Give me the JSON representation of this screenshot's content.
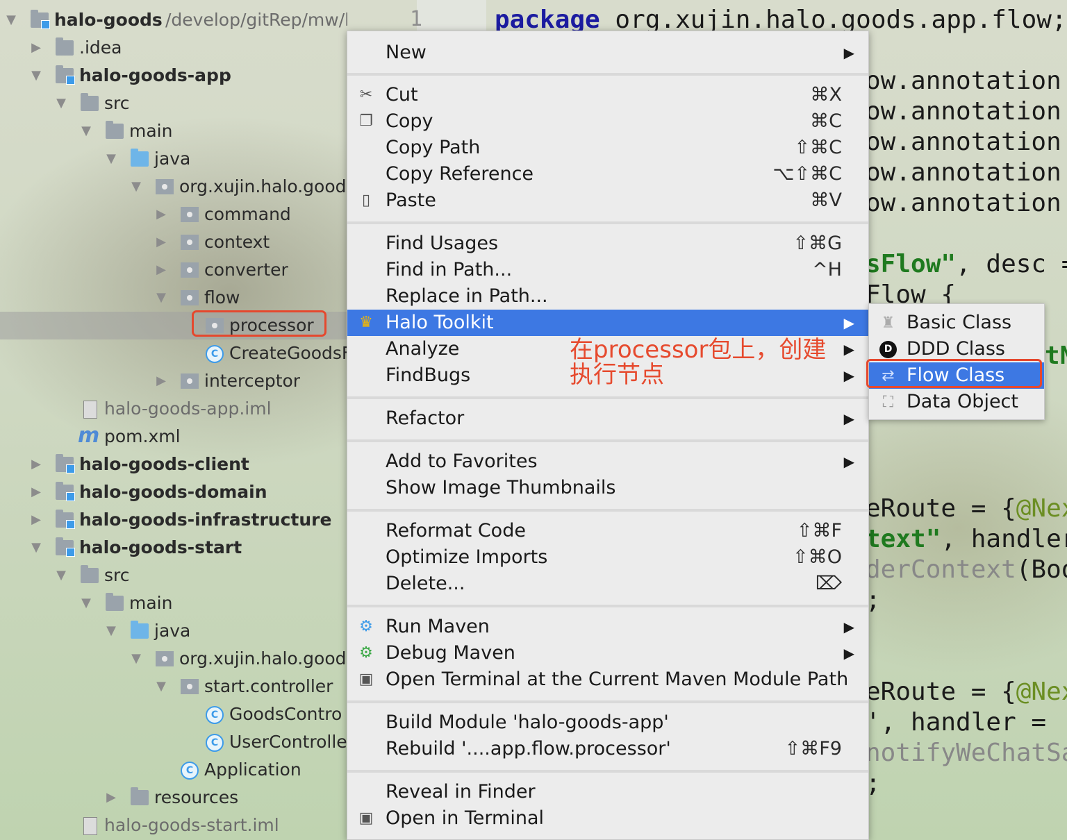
{
  "tree": {
    "root": {
      "label": "halo-goods",
      "path": "/develop/gitRep/mw/halo-g"
    },
    "items": [
      {
        "label": "halo-goods-app"
      },
      {
        "label": ".idea"
      },
      {
        "label": "src"
      },
      {
        "label": "main"
      },
      {
        "label": "java"
      },
      {
        "label": "org.xujin.halo.goods"
      },
      {
        "label": "command"
      },
      {
        "label": "context"
      },
      {
        "label": "converter"
      },
      {
        "label": "flow"
      },
      {
        "label": "processor"
      },
      {
        "label": "CreateGoodsF"
      },
      {
        "label": "interceptor"
      },
      {
        "label": "halo-goods-app.iml"
      },
      {
        "label": "pom.xml"
      },
      {
        "label": "halo-goods-client"
      },
      {
        "label": "halo-goods-domain"
      },
      {
        "label": "halo-goods-infrastructure"
      },
      {
        "label": "halo-goods-start"
      },
      {
        "label": "src"
      },
      {
        "label": "main"
      },
      {
        "label": "java"
      },
      {
        "label": "org.xujin.halo.goods"
      },
      {
        "label": "start.controller"
      },
      {
        "label": "GoodsContro"
      },
      {
        "label": "UserControlle"
      },
      {
        "label": "Application"
      },
      {
        "label": "resources"
      },
      {
        "label": "halo-goods-start.iml"
      }
    ]
  },
  "editor": {
    "line_number": "1",
    "lines": {
      "l1_kw": "package",
      "l1": " org.xujin.halo.goods.app.flow;",
      "l2": "ow.annotation.",
      "l3": "ow.annotation.",
      "l4": "ow.annotation.",
      "l5": "ow.annotation.",
      "l6": "ow.annotation.",
      "l7_str": "sFlow\"",
      "l7": ", desc =",
      "l8": "Flow {",
      "l9_str": "tN",
      "l10": "eRoute = {",
      "l10_ann": "@Nex",
      "l11_str": "text\"",
      "l11": ", handler",
      "l12_gr": "derContext",
      "l12": "(Boo",
      "l13": ";",
      "l14": "eRoute = {",
      "l14_ann": "@Nex",
      "l15": "', handler = '",
      "l16_gr": "notifyWeChatSa",
      "l17": ";"
    }
  },
  "menu": {
    "items": [
      {
        "label": "New",
        "shortcut": "",
        "submenu": true
      },
      {
        "label": "Cut",
        "shortcut": "⌘X",
        "icon": "scissors-icon"
      },
      {
        "label": "Copy",
        "shortcut": "⌘C",
        "icon": "copy-icon"
      },
      {
        "label": "Copy Path",
        "shortcut": "⇧⌘C"
      },
      {
        "label": "Copy Reference",
        "shortcut": "⌥⇧⌘C"
      },
      {
        "label": "Paste",
        "shortcut": "⌘V",
        "icon": "clipboard-icon"
      },
      {
        "label": "Find Usages",
        "shortcut": "⇧⌘G"
      },
      {
        "label": "Find in Path...",
        "shortcut": "^H"
      },
      {
        "label": "Replace in Path...",
        "shortcut": ""
      },
      {
        "label": "Halo Toolkit",
        "shortcut": "",
        "submenu": true,
        "icon": "crown-icon"
      },
      {
        "label": "Analyze",
        "shortcut": "",
        "submenu": true
      },
      {
        "label": "FindBugs",
        "shortcut": "",
        "submenu": true
      },
      {
        "label": "Refactor",
        "shortcut": "",
        "submenu": true
      },
      {
        "label": "Add to Favorites",
        "shortcut": "",
        "submenu": true
      },
      {
        "label": "Show Image Thumbnails",
        "shortcut": ""
      },
      {
        "label": "Reformat Code",
        "shortcut": "⇧⌘F"
      },
      {
        "label": "Optimize Imports",
        "shortcut": "⇧⌘O"
      },
      {
        "label": "Delete...",
        "shortcut": "⌦"
      },
      {
        "label": "Run Maven",
        "shortcut": "",
        "submenu": true,
        "icon": "maven-gear-icon"
      },
      {
        "label": "Debug Maven",
        "shortcut": "",
        "submenu": true,
        "icon": "maven-debug-icon"
      },
      {
        "label": "Open Terminal at the Current Maven Module Path",
        "shortcut": "",
        "icon": "terminal-icon"
      },
      {
        "label": "Build Module 'halo-goods-app'",
        "shortcut": ""
      },
      {
        "label": "Rebuild '....app.flow.processor'",
        "shortcut": "⇧⌘F9"
      },
      {
        "label": "Reveal in Finder",
        "shortcut": ""
      },
      {
        "label": "Open in Terminal",
        "shortcut": "",
        "icon": "terminal-icon"
      }
    ],
    "submenu_arrow": "▶",
    "annotation": "在processor包上，创建执行节点"
  },
  "submenu": {
    "items": [
      {
        "label": "Basic Class",
        "icon": "basic-class-icon"
      },
      {
        "label": "DDD Class",
        "icon": "ddd-class-icon",
        "badge": "D"
      },
      {
        "label": "Flow Class",
        "icon": "flow-class-icon"
      },
      {
        "label": "Data Object",
        "icon": "data-object-icon"
      }
    ]
  },
  "colors": {
    "highlight": "#3d78e3",
    "annotation_red": "#e64a2e",
    "keyword": "#1b1ba0",
    "string": "#1f7a1f"
  }
}
